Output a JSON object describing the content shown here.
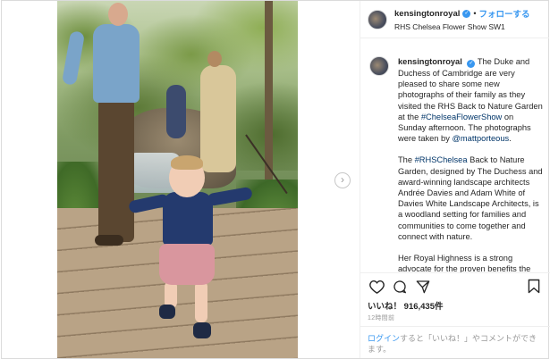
{
  "post": {
    "username": "kensingtonroyal",
    "follow_label": "フォローする",
    "location": "RHS Chelsea Flower Show SW1"
  },
  "caption": {
    "p1_a": "The Duke and Duchess of Cambridge are very pleased to share some new photographs of their family as they visited the RHS Back to Nature Garden at the ",
    "p1_tag": "#ChelseaFlowerShow",
    "p1_b": " on Sunday afternoon. The photographs were taken by ",
    "p1_mention": "@mattporteous",
    "p1_c": ".",
    "p2_a": "The ",
    "p2_tag": "#RHSChelsea",
    "p2_b": " Back to Nature Garden, designed by The Duchess and award-winning landscape architects Andrée Davies and Adam White of Davies White Landscape Architects, is a woodland setting for families and communities to come together and connect with nature.",
    "p3": "Her Royal Highness is a strong advocate for the proven benefits the"
  },
  "stats": {
    "likes_label": "いいね！",
    "likes_count": "916,435件",
    "time": "12時間前"
  },
  "login": {
    "link": "ログイン",
    "rest": "すると「いいね！」やコメントができます。"
  },
  "icons": {
    "like": "heart-icon",
    "comment": "comment-icon",
    "share": "share-icon",
    "save": "bookmark-icon",
    "next": "chevron-right-icon",
    "verified": "verified-badge-icon"
  },
  "colors": {
    "link_blue": "#3897f0",
    "hashtag": "#003569",
    "border": "#dbdbdb"
  }
}
